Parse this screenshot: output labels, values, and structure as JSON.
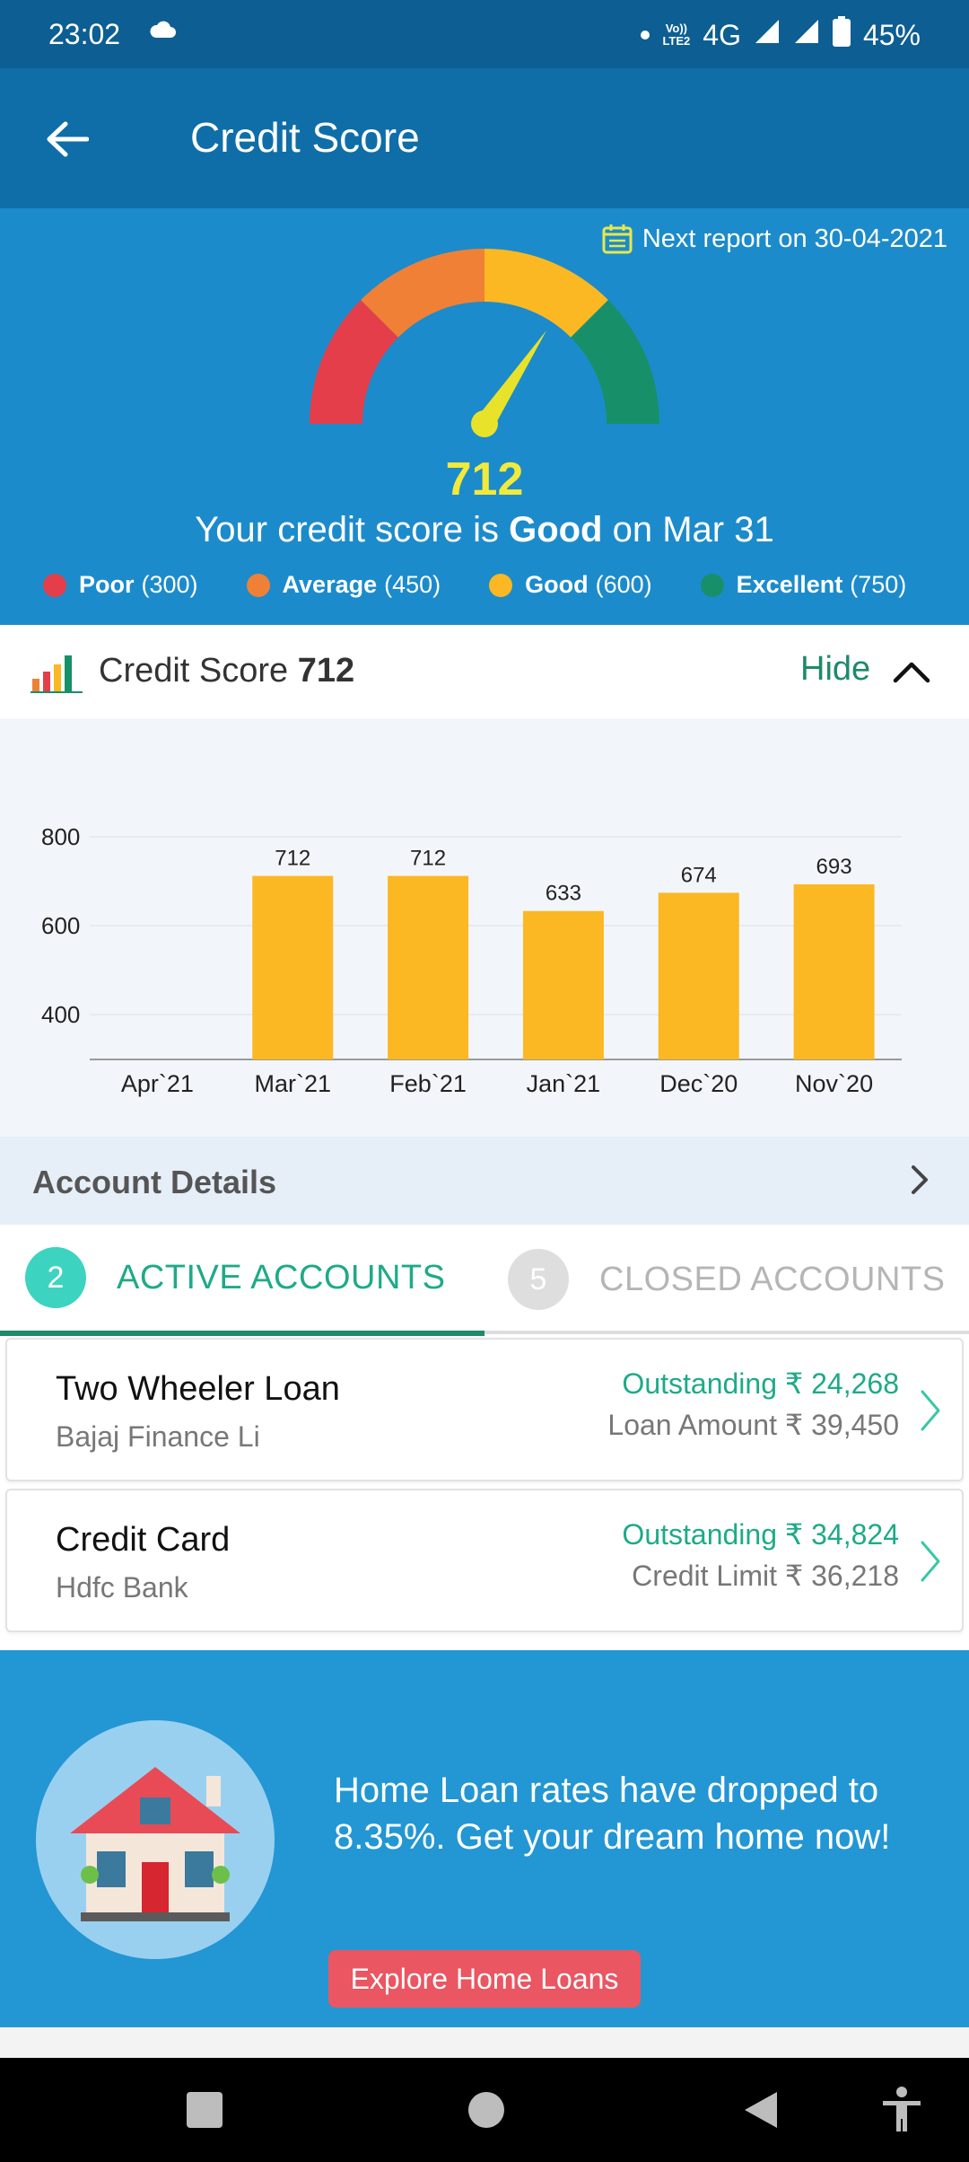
{
  "status_bar": {
    "time": "23:02",
    "network_volte_top": "Vo))",
    "network_volte_bottom": "LTE2",
    "network": "4G",
    "battery": "45%"
  },
  "app_bar": {
    "title": "Credit Score"
  },
  "score_panel": {
    "next_report": "Next report on 30-04-2021",
    "score": "712",
    "score_text_prefix": "Your credit score is ",
    "score_rating": "Good",
    "score_text_suffix": " on Mar 31",
    "needle_score": 712,
    "legend": [
      {
        "label": "Poor",
        "value": "(300)",
        "color": "#e33e4a"
      },
      {
        "label": "Average",
        "value": "(450)",
        "color": "#f08036"
      },
      {
        "label": "Good",
        "value": "(600)",
        "color": "#fbb823"
      },
      {
        "label": "Excellent",
        "value": "(750)",
        "color": "#17906a"
      }
    ]
  },
  "credit_header": {
    "title": "Credit Score",
    "score": "712",
    "hide_label": "Hide"
  },
  "chart_data": {
    "type": "bar",
    "categories": [
      "Apr`21",
      "Mar`21",
      "Feb`21",
      "Jan`21",
      "Dec`20",
      "Nov`20"
    ],
    "values": [
      null,
      712,
      712,
      633,
      674,
      693
    ],
    "data_labels": [
      "",
      "712",
      "712",
      "633",
      "674",
      "693"
    ],
    "yticks": [
      "800",
      "600",
      "400"
    ],
    "ytick_values": [
      800,
      600,
      400
    ],
    "ylim": [
      300,
      800
    ],
    "bar_color": "#fbb823",
    "grid": true
  },
  "account_details": {
    "title": "Account Details"
  },
  "tabs": {
    "active": {
      "count": "2",
      "label": "ACTIVE ACCOUNTS"
    },
    "closed": {
      "count": "5",
      "label": "CLOSED ACCOUNTS"
    }
  },
  "accounts": [
    {
      "title": "Two Wheeler Loan",
      "lender": "Bajaj Finance Li",
      "outstanding": "Outstanding ₹ 24,268",
      "amount": "Loan Amount ₹ 39,450"
    },
    {
      "title": "Credit Card",
      "lender": "Hdfc Bank",
      "outstanding": "Outstanding ₹ 34,824",
      "amount": "Credit Limit ₹ 36,218"
    }
  ],
  "promo": {
    "text": "Home Loan rates have dropped to 8.35%. Get your dream home now!",
    "button": "Explore Home Loans"
  },
  "icons": {
    "back": "arrow-left-icon",
    "calendar": "calendar-icon",
    "bar_chart": "bar-chart-icon",
    "chevron_up": "chevron-up-icon",
    "chevron_right": "chevron-right-icon"
  }
}
